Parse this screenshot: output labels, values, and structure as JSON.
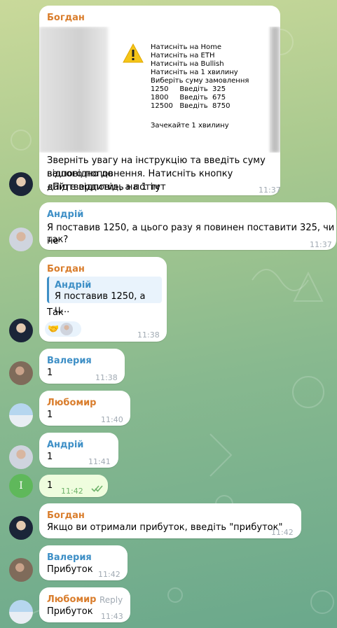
{
  "chat": {
    "messages": [
      {
        "sender": "Богдан",
        "image_lines": [
          "Натисніть на Home",
          "Натисніть на ЕТН",
          "Натисніть на Bullish",
          "Натисніть на 1 хвилину",
          "Виберіть суму замовлення",
          "1250     Введіть  325",
          "1800     Введіть  675",
          "12500   Введіть  8750",
          "",
          "Зачекайте 1 хвилину"
        ],
        "text_lines": [
          "Зверніть увагу на інструкцію та введіть суму відповідно до",
          "вашого поповнення. Натисніть кнопку «Підтвердити», а потім",
          "дайте відповідь на 1 тут"
        ],
        "time": "11:37"
      },
      {
        "sender": "Андрій",
        "text_lines": [
          "Я поставив 1250, а цього разу я повинен поставити 325, чи не",
          "так?"
        ],
        "time": "11:37"
      },
      {
        "sender": "Богдан",
        "quote_sender": "Андрій",
        "quote_text": "Я поставив 1250, а ц...",
        "text": "Так",
        "reaction": "🤝",
        "time": "11:38"
      },
      {
        "sender": "Валерия",
        "text": "1",
        "time": "11:38"
      },
      {
        "sender": "Любомир",
        "text": "1",
        "time": "11:40"
      },
      {
        "sender": "Андрій",
        "text": "1",
        "time": "11:41"
      },
      {
        "avatar_letter": "I",
        "text": "1",
        "time": "11:42",
        "status": "read"
      },
      {
        "sender": "Богдан",
        "text": "Якщо ви отримали прибуток, введіть \"прибуток\"",
        "time": "11:42"
      },
      {
        "sender": "Валерия",
        "text": "Прибуток",
        "time": "11:42"
      },
      {
        "sender": "Любомир",
        "reply_label": "Reply",
        "text": "Прибуток",
        "time": "11:43"
      }
    ]
  },
  "colors": {
    "sender_orange": "#d97d2c",
    "sender_blue": "#3e8fc6",
    "outgoing_bubble": "#effdde",
    "incoming_bubble": "#ffffff"
  }
}
